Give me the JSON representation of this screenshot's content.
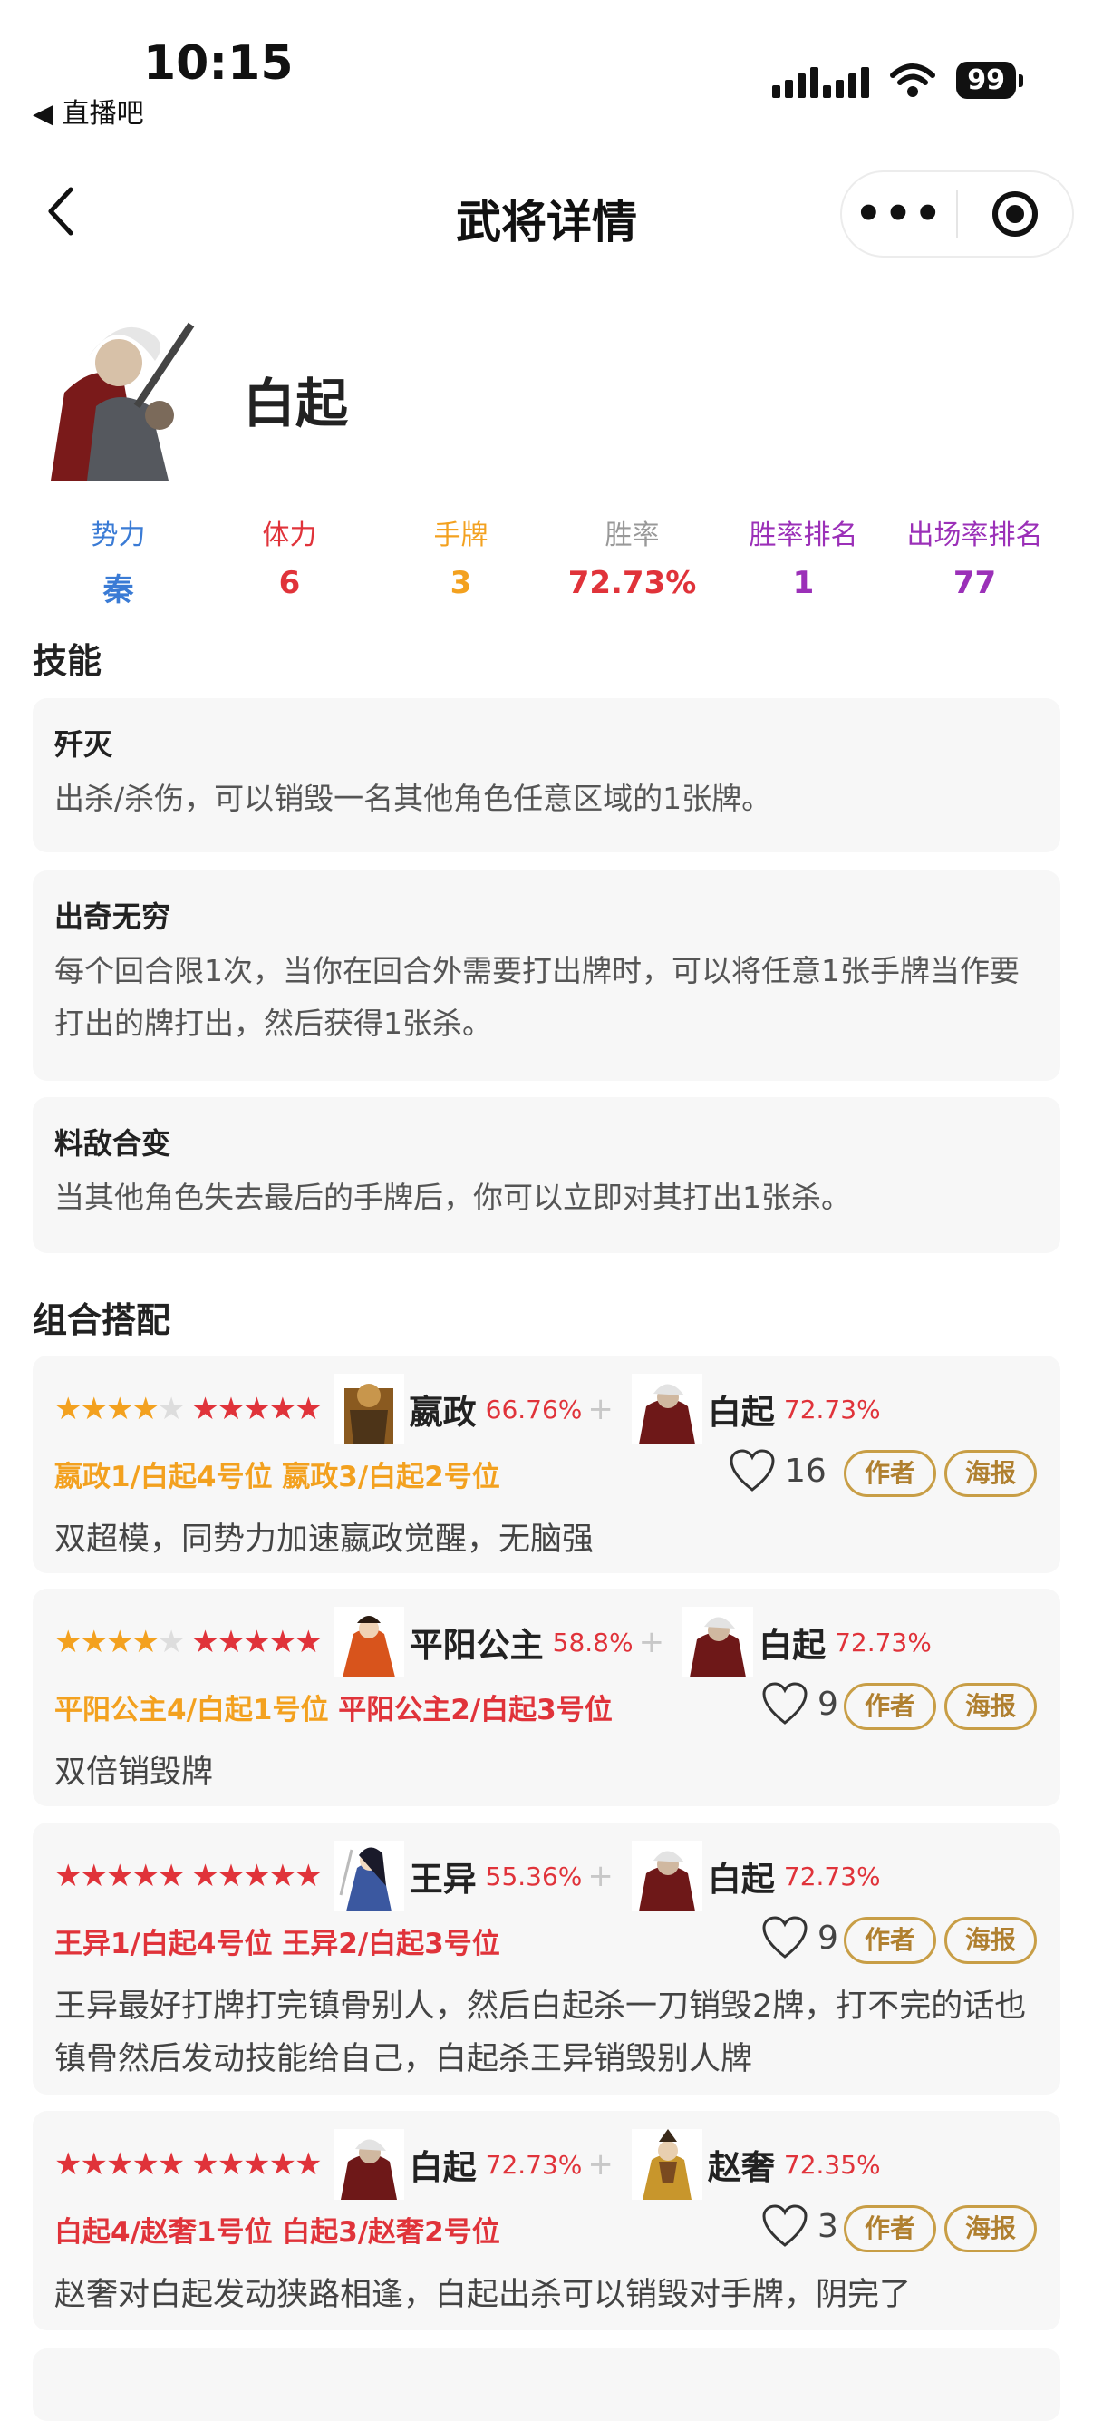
{
  "status_bar": {
    "time": "10:15",
    "back_app": "◀ 直播吧",
    "battery": "99"
  },
  "nav": {
    "title": "武将详情",
    "more_icon": "•••"
  },
  "hero": {
    "name": "白起",
    "stats": [
      {
        "label": "势力",
        "value": "秦",
        "color": "#3a7bd5"
      },
      {
        "label": "体力",
        "value": "6",
        "color": "#e0333a"
      },
      {
        "label": "手牌",
        "value": "3",
        "color": "#f3a11f"
      },
      {
        "label": "胜率",
        "value": "72.73%",
        "label_color": "#999999",
        "color": "#e0333a"
      },
      {
        "label": "胜率排名",
        "value": "1",
        "color": "#9b30b8"
      },
      {
        "label": "出场率排名",
        "value": "77",
        "color": "#9b30b8"
      }
    ]
  },
  "skills_title": "技能",
  "skills": [
    {
      "name": "歼灭",
      "desc": "出杀/杀伤，可以销毁一名其他角色任意区域的1张牌。"
    },
    {
      "name": "出奇无穷",
      "desc": "每个回合限1次，当你在回合外需要打出牌时，可以将任意1张手牌当作要打出的牌打出，然后获得1张杀。"
    },
    {
      "name": "料敌合变",
      "desc": "当其他角色失去最后的手牌后，你可以立即对其打出1张杀。"
    }
  ],
  "combos_title": "组合搭配",
  "combos": [
    {
      "stars1": {
        "filled": 4,
        "color": "orange"
      },
      "stars2": {
        "filled": 5,
        "color": "red"
      },
      "a_name": "嬴政",
      "a_rate": "66.76%",
      "plus": "+",
      "b_name": "白起",
      "b_rate": "72.73%",
      "pos1": "嬴政1/白起4号位",
      "pos2": "嬴政3/白起2号位",
      "pos_color": "orange",
      "likes": "16",
      "btn_author": "作者",
      "btn_poster": "海报",
      "desc": "双超模，同势力加速嬴政觉醒，无脑强"
    },
    {
      "stars1": {
        "filled": 4,
        "color": "orange"
      },
      "stars2": {
        "filled": 5,
        "color": "red"
      },
      "a_name": "平阳公主",
      "a_rate": "58.8%",
      "plus": "+",
      "b_name": "白起",
      "b_rate": "72.73%",
      "pos1": "平阳公主4/白起1号位",
      "pos2": "平阳公主2/白起3号位",
      "pos_color": "mixed",
      "likes": "9",
      "btn_author": "作者",
      "btn_poster": "海报",
      "desc": "双倍销毁牌"
    },
    {
      "stars1": {
        "filled": 5,
        "color": "red"
      },
      "stars2": {
        "filled": 5,
        "color": "red"
      },
      "a_name": "王异",
      "a_rate": "55.36%",
      "plus": "+",
      "b_name": "白起",
      "b_rate": "72.73%",
      "pos1": "王异1/白起4号位",
      "pos2": "王异2/白起3号位",
      "pos_color": "red",
      "likes": "9",
      "btn_author": "作者",
      "btn_poster": "海报",
      "desc": "王异最好打牌打完镇骨别人，然后白起杀一刀销毁2牌，打不完的话也镇骨然后发动技能给自己，白起杀王异销毁别人牌"
    },
    {
      "stars1": {
        "filled": 5,
        "color": "red"
      },
      "stars2": {
        "filled": 5,
        "color": "red"
      },
      "a_name": "白起",
      "a_rate": "72.73%",
      "plus": "+",
      "b_name": "赵奢",
      "b_rate": "72.35%",
      "pos1": "白起4/赵奢1号位",
      "pos2": "白起3/赵奢2号位",
      "pos_color": "red",
      "likes": "3",
      "btn_author": "作者",
      "btn_poster": "海报",
      "desc": "赵奢对白起发动狭路相逢，白起出杀可以销毁对手牌，阴完了"
    }
  ]
}
